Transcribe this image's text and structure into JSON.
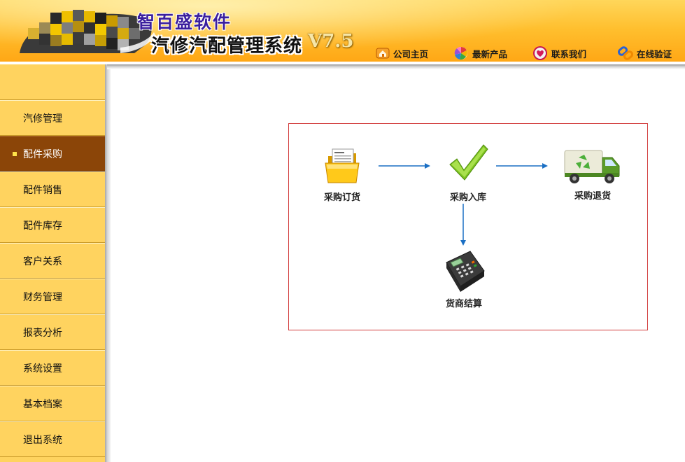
{
  "header": {
    "brand": "智百盛软件",
    "system_title": "汽修汽配管理系统",
    "version": "V7.5",
    "nav": [
      {
        "label": "公司主页",
        "icon": "home-icon"
      },
      {
        "label": "最新产品",
        "icon": "color-wheel-icon"
      },
      {
        "label": "联系我们",
        "icon": "heart-icon"
      },
      {
        "label": "在线验证",
        "icon": "link-icon"
      }
    ]
  },
  "sidebar": {
    "active_index": 1,
    "items": [
      {
        "label": "汽修管理"
      },
      {
        "label": "配件采购"
      },
      {
        "label": "配件销售"
      },
      {
        "label": "配件库存"
      },
      {
        "label": "客户关系"
      },
      {
        "label": "财务管理"
      },
      {
        "label": "报表分析"
      },
      {
        "label": "系统设置"
      },
      {
        "label": "基本档案"
      },
      {
        "label": "退出系统"
      }
    ]
  },
  "workflow": {
    "nodes": [
      {
        "label": "采购订货",
        "icon": "folder-document-icon"
      },
      {
        "label": "采购入库",
        "icon": "checkmark-icon"
      },
      {
        "label": "采购退货",
        "icon": "recycle-truck-icon"
      },
      {
        "label": "货商结算",
        "icon": "pos-terminal-icon"
      }
    ],
    "arrow_color": "#1a6fc4",
    "border_color": "#d23c3c"
  },
  "colors": {
    "header_top": "#ffd65a",
    "header_bottom": "#ffa513",
    "sidebar_bg": "#ffd35f",
    "sidebar_active_bg": "#8b4508",
    "sidebar_active_bullet": "#ffe34a"
  }
}
